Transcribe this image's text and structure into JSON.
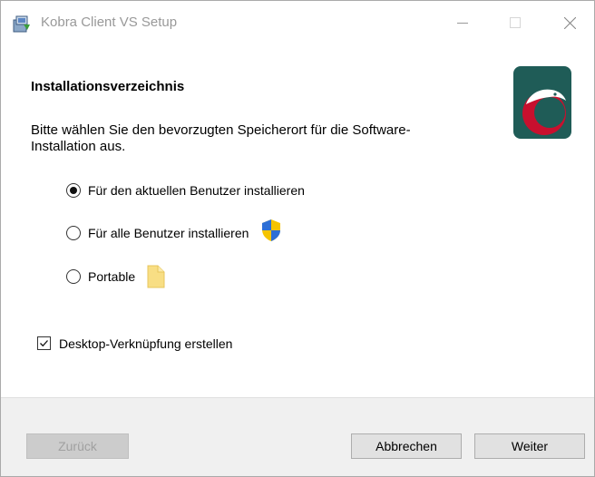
{
  "window": {
    "title": "Kobra Client VS Setup"
  },
  "content": {
    "heading": "Installationsverzeichnis",
    "description": "Bitte wählen Sie den bevorzugten Speicherort für die Software-Installation aus.",
    "options": [
      {
        "label": "Für den aktuellen Benutzer installieren",
        "selected": true,
        "icon": ""
      },
      {
        "label": "Für alle Benutzer installieren",
        "selected": false,
        "icon": "uac-shield-icon"
      },
      {
        "label": "Portable",
        "selected": false,
        "icon": "folder-icon"
      }
    ],
    "desktop_shortcut": {
      "label": "Desktop-Verknüpfung erstellen",
      "checked": true
    }
  },
  "buttons": {
    "back": "Zurück",
    "cancel": "Abbrechen",
    "next": "Weiter"
  },
  "colors": {
    "logo_background": "#1f5c57",
    "logo_accent": "#c8102e"
  }
}
